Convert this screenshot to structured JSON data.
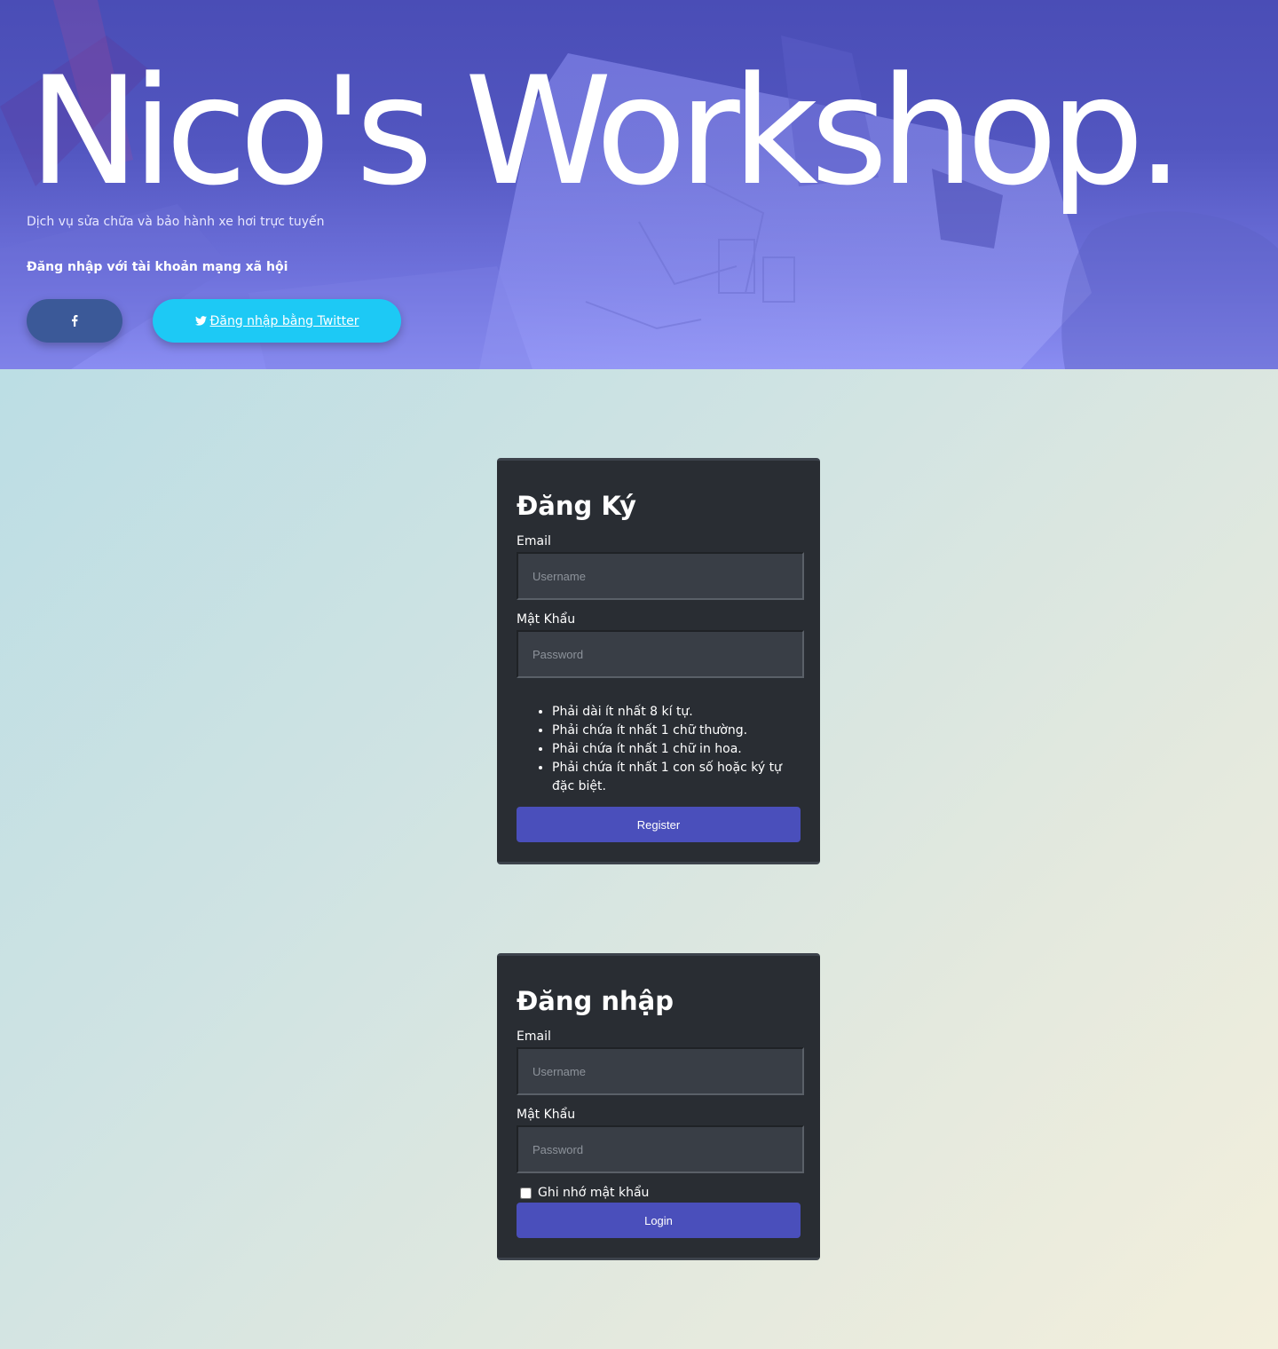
{
  "hero": {
    "title": "Nico's Workshop.",
    "subtitle": "Dịch vụ sửa chữa và bảo hành xe hơi trực tuyến",
    "social_heading": "Đăng nhập với tài khoản mạng xã hội",
    "facebook_icon": "f",
    "twitter_icon": "twitter-bird-icon",
    "twitter_label": "Đăng nhập bằng Twitter"
  },
  "register": {
    "title": "Đăng Ký",
    "email_label": "Email",
    "email_placeholder": "Username",
    "password_label": "Mật Khẩu",
    "password_placeholder": "Password",
    "rules": [
      "Phải dài ít nhất 8 kí tự.",
      "Phải chứa ít nhất 1 chữ thường.",
      "Phải chứa ít nhất 1 chữ in hoa.",
      "Phải chứa ít nhất 1 con số hoặc ký tự đặc biệt."
    ],
    "submit_label": "Register"
  },
  "login": {
    "title": "Đăng nhập",
    "email_label": "Email",
    "email_placeholder": "Username",
    "password_label": "Mật Khẩu",
    "password_placeholder": "Password",
    "remember_label": "Ghi nhớ mật khẩu",
    "remember_checked": false,
    "submit_label": "Login"
  },
  "colors": {
    "hero_top": "#4a4db6",
    "facebook": "#3b5998",
    "twitter": "#1dc9f5",
    "card": "#292d33",
    "primary_button": "#4a4fbb"
  }
}
